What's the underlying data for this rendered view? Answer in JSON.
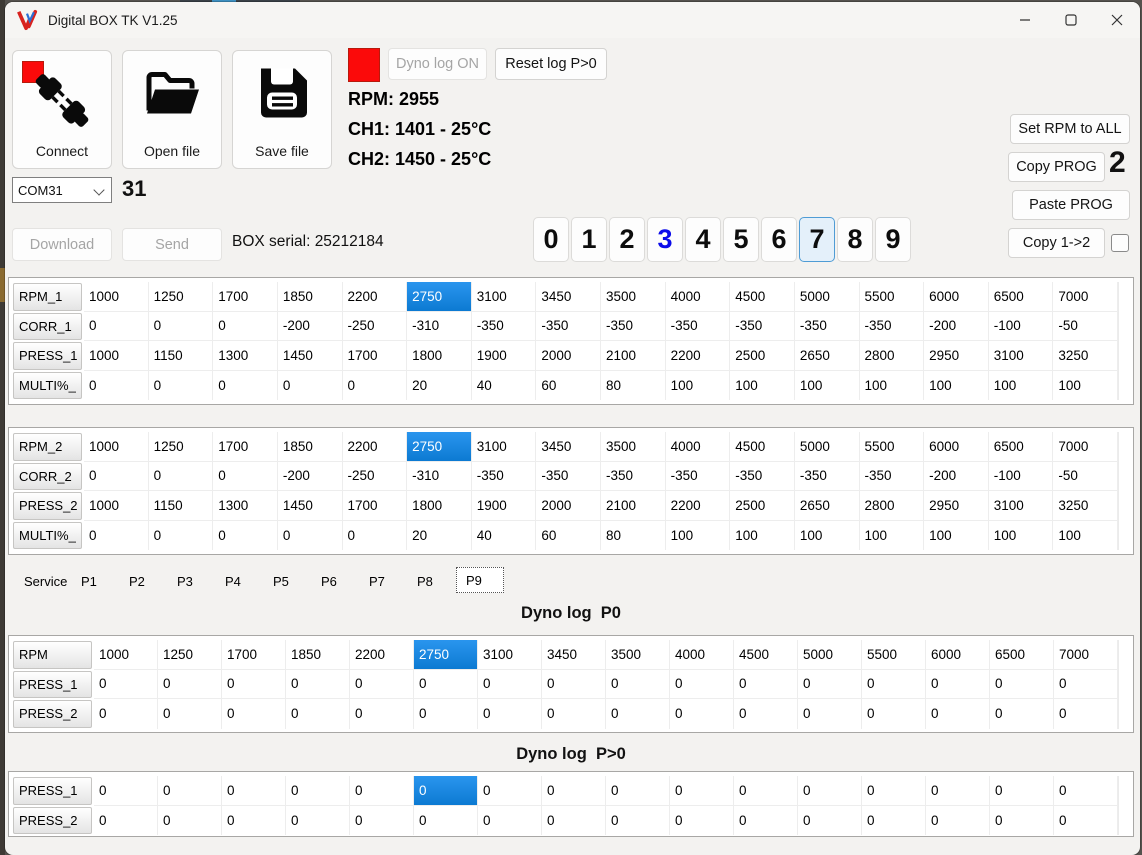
{
  "titlebar": {
    "title": "Digital BOX TK V1.25"
  },
  "toolbar": {
    "connect": "Connect",
    "open_file": "Open file",
    "save_file": "Save file"
  },
  "logger": {
    "dyno_log_on": "Dyno log ON",
    "reset_log": "Reset log P>0"
  },
  "telemetry": {
    "rpm": "RPM: 2955",
    "ch1": "CH1: 1401 - 25°C",
    "ch2": "CH2: 1450 - 25°C"
  },
  "side_actions": {
    "set_rpm_to_all": "Set RPM to ALL",
    "copy_prog": "Copy PROG",
    "copy_prog_value": "2",
    "paste_prog": "Paste PROG",
    "copy_1_to_2": "Copy 1->2"
  },
  "connection": {
    "com_port": "COM31",
    "com_number": "31",
    "download": "Download",
    "send": "Send",
    "box_serial": "BOX serial: 25212184"
  },
  "prog_selector": {
    "digits": [
      "0",
      "1",
      "2",
      "3",
      "4",
      "5",
      "6",
      "7",
      "8",
      "9"
    ],
    "active_digit": "3",
    "focused_digit": "7"
  },
  "tab_bar": {
    "tabs": [
      "Service",
      "P1",
      "P2",
      "P3",
      "P4",
      "P5",
      "P6",
      "P7",
      "P8",
      "P9"
    ],
    "selected": "P9"
  },
  "colors": {
    "selection_blue": "#1487e8",
    "active_digit_blue": "#0b0bea",
    "indicator_red": "#fb0a0a"
  },
  "tables": {
    "prog1": {
      "selected_row": 0,
      "selected_col": 5,
      "rows": [
        {
          "label": "RPM_1",
          "values": [
            1000,
            1250,
            1700,
            1850,
            2200,
            2750,
            3100,
            3450,
            3500,
            4000,
            4500,
            5000,
            5500,
            6000,
            6500,
            7000
          ]
        },
        {
          "label": "CORR_1",
          "values": [
            0,
            0,
            0,
            -200,
            -250,
            -310,
            -350,
            -350,
            -350,
            -350,
            -350,
            -350,
            -350,
            -200,
            -100,
            -50
          ]
        },
        {
          "label": "PRESS_1",
          "values": [
            1000,
            1150,
            1300,
            1450,
            1700,
            1800,
            1900,
            2000,
            2100,
            2200,
            2500,
            2650,
            2800,
            2950,
            3100,
            3250
          ]
        },
        {
          "label": "MULTI%_",
          "values": [
            0,
            0,
            0,
            0,
            0,
            20,
            40,
            60,
            80,
            100,
            100,
            100,
            100,
            100,
            100,
            100
          ]
        }
      ]
    },
    "prog2": {
      "selected_row": 0,
      "selected_col": 5,
      "rows": [
        {
          "label": "RPM_2",
          "values": [
            1000,
            1250,
            1700,
            1850,
            2200,
            2750,
            3100,
            3450,
            3500,
            4000,
            4500,
            5000,
            5500,
            6000,
            6500,
            7000
          ]
        },
        {
          "label": "CORR_2",
          "values": [
            0,
            0,
            0,
            -200,
            -250,
            -310,
            -350,
            -350,
            -350,
            -350,
            -350,
            -350,
            -350,
            -200,
            -100,
            -50
          ]
        },
        {
          "label": "PRESS_2",
          "values": [
            1000,
            1150,
            1300,
            1450,
            1700,
            1800,
            1900,
            2000,
            2100,
            2200,
            2500,
            2650,
            2800,
            2950,
            3100,
            3250
          ]
        },
        {
          "label": "MULTI%_",
          "values": [
            0,
            0,
            0,
            0,
            0,
            20,
            40,
            60,
            80,
            100,
            100,
            100,
            100,
            100,
            100,
            100
          ]
        }
      ]
    },
    "dyno_p0": {
      "title": "Dyno log  P0",
      "selected_row": 0,
      "selected_col": 5,
      "rows": [
        {
          "label": "RPM",
          "values": [
            1000,
            1250,
            1700,
            1850,
            2200,
            2750,
            3100,
            3450,
            3500,
            4000,
            4500,
            5000,
            5500,
            6000,
            6500,
            7000
          ]
        },
        {
          "label": "PRESS_1",
          "values": [
            0,
            0,
            0,
            0,
            0,
            0,
            0,
            0,
            0,
            0,
            0,
            0,
            0,
            0,
            0,
            0
          ]
        },
        {
          "label": "PRESS_2",
          "values": [
            0,
            0,
            0,
            0,
            0,
            0,
            0,
            0,
            0,
            0,
            0,
            0,
            0,
            0,
            0,
            0
          ]
        }
      ]
    },
    "dyno_p_gt_0": {
      "title": "Dyno log  P>0",
      "selected_row": 0,
      "selected_col": 5,
      "rows": [
        {
          "label": "PRESS_1",
          "values": [
            0,
            0,
            0,
            0,
            0,
            0,
            0,
            0,
            0,
            0,
            0,
            0,
            0,
            0,
            0,
            0
          ]
        },
        {
          "label": "PRESS_2",
          "values": [
            0,
            0,
            0,
            0,
            0,
            0,
            0,
            0,
            0,
            0,
            0,
            0,
            0,
            0,
            0,
            0
          ]
        }
      ]
    }
  }
}
